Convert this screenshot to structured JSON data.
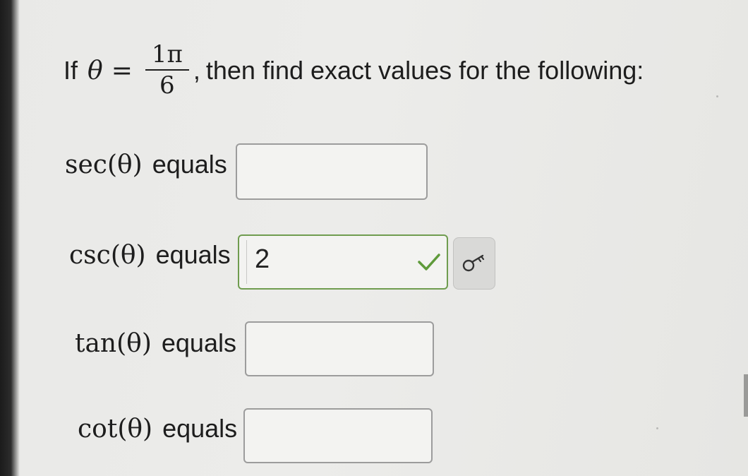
{
  "question": {
    "prefix": "If",
    "theta": "θ",
    "equals": "=",
    "numerator": "1π",
    "denominator": "6",
    "comma": ",",
    "suffix": "then find exact values for the following:"
  },
  "rows": [
    {
      "fn": "sec",
      "theta": "(θ)",
      "equals_word": "equals",
      "value": "",
      "status": "empty"
    },
    {
      "fn": "csc",
      "theta": "(θ)",
      "equals_word": "equals",
      "value": "2",
      "status": "correct"
    },
    {
      "fn": "tan",
      "theta": "(θ)",
      "equals_word": "equals",
      "value": "",
      "status": "empty"
    },
    {
      "fn": "cot",
      "theta": "(θ)",
      "equals_word": "equals",
      "value": "",
      "status": "empty"
    }
  ],
  "icons": {
    "check": "check-icon",
    "key": "key-icon"
  },
  "colors": {
    "correct_border": "#6f9c4f",
    "check": "#5e9a3a",
    "key_button_bg": "#d9d9d7"
  }
}
